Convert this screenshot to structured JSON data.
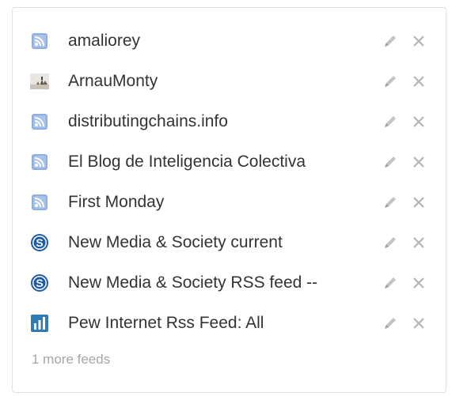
{
  "feeds": [
    {
      "title": "amaliorey",
      "icon": "rss-icon"
    },
    {
      "title": "ArnauMonty",
      "icon": "avatar-thumbnail-icon"
    },
    {
      "title": "distributingchains.info",
      "icon": "rss-icon"
    },
    {
      "title": "El Blog de Inteligencia Colectiva",
      "icon": "rss-icon"
    },
    {
      "title": "First Monday",
      "icon": "rss-icon"
    },
    {
      "title": "New Media & Society current",
      "icon": "sage-s-icon"
    },
    {
      "title": "New Media & Society RSS feed --",
      "icon": "sage-s-icon"
    },
    {
      "title": "Pew Internet Rss Feed: All",
      "icon": "bar-chart-icon"
    }
  ],
  "actions": {
    "edit_icon": "pencil-icon",
    "remove_icon": "close-icon"
  },
  "more_feeds_label": "1 more feeds",
  "colors": {
    "text": "#333333",
    "muted": "#a6a6a6",
    "rss_blue": "#7b9fd6",
    "sage_blue": "#1d5aa8",
    "pew_blue": "#2e7bb6",
    "action_gray": "#b5b5b5"
  }
}
